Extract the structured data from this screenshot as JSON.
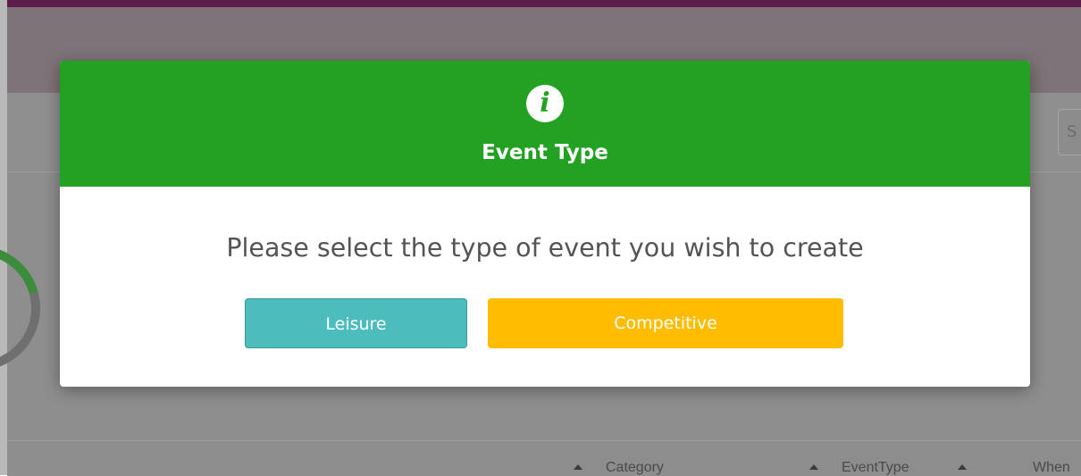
{
  "background": {
    "search_placeholder": "S",
    "table_headers": [
      "Category",
      "EventType",
      "When"
    ]
  },
  "modal": {
    "icon": "info-icon",
    "title": "Event Type",
    "message": "Please select the type of event you wish to create",
    "buttons": {
      "leisure_label": "Leisure",
      "competitive_label": "Competitive"
    },
    "colors": {
      "header": "#22a122",
      "leisure": "#4cbcbc",
      "competitive": "#ffbc00"
    }
  }
}
